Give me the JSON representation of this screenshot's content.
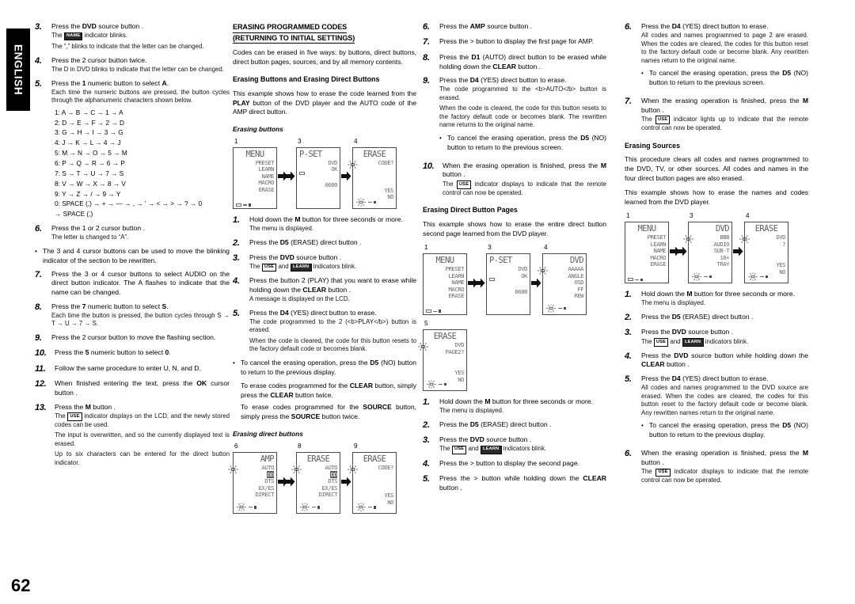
{
  "meta": {
    "language_tab": "ENGLISH",
    "page_number": "62"
  },
  "col1": {
    "steps": [
      {
        "num": "3.",
        "lead_pre": "Press the ",
        "lead_b": "DVD",
        "lead_post": " source button .",
        "notes": [
          "The NAME indicator blinks.",
          "The “,” blinks to indicate that the letter can be changed."
        ],
        "chip": "NAME"
      },
      {
        "num": "4.",
        "lead": "Press the 2  cursor button twice.",
        "notes": [
          "The D in DVD blinks to indicate that the letter can be changed."
        ]
      },
      {
        "num": "5.",
        "lead_pre": "Press the ",
        "lead_b": "1",
        "lead_mid": " numeric button to select ",
        "lead_b2": "A",
        "lead_post": ".",
        "notes": [
          "Each time the numeric buttons are pressed, the button cycles through the alphanumeric characters shown below."
        ]
      },
      {
        "num": "6.",
        "lead": "Press the 1 or 2 cursor button .",
        "notes": [
          "The letter is changed to “A”."
        ]
      },
      {
        "num": "7.",
        "lead": "Press the 3  or 4  cursor buttons to select AUDIO on the direct button indicator. The A flashes to indicate that the name can be changed."
      },
      {
        "num": "8.",
        "lead_pre": "Press the ",
        "lead_b": "7",
        "lead_mid": " numeric button to select ",
        "lead_b2": "S",
        "lead_post": ".",
        "notes": [
          "Each time the button is pressed, the button cycles through S → T → U → 7 → S."
        ]
      },
      {
        "num": "9.",
        "lead": "Press the 2  cursor button to move the flashing section."
      },
      {
        "num": "10.",
        "lead_pre": "Press the ",
        "lead_b": "5",
        "lead_mid": " numeric button to select ",
        "lead_b2": "0",
        "lead_post": "."
      },
      {
        "num": "11.",
        "lead": "Follow the same procedure to enter U, N, and D."
      },
      {
        "num": "12.",
        "lead_pre": "When finished entering the text, press the ",
        "lead_b": "OK",
        "lead_post": " cursor button ."
      },
      {
        "num": "13.",
        "lead_pre": "Press the ",
        "lead_b": "M",
        "lead_post": " button .",
        "notes": [
          "The USE indicator displays on the LCD, and the newly stored codes can be used.",
          "The input is overwritten, and so the currently displayed text is erased.",
          "Up to six characters can be entered for the direct button indicator."
        ]
      }
    ],
    "bullet_after_6": "The 3  and 4  cursor buttons can be used to move the blinking indicator of the section to be rewritten.",
    "cycle": [
      "1: A → B → C → 1 → A",
      "2: D → E → F → 2 → D",
      "3: G → H → I → 3 → G",
      "4: J → K → L → 4 → J",
      "5: M → N → O → 5 → M",
      "6: P → Q → R → 6 → P",
      "7: S → T → U → 7 → S",
      "8: V → W → X → 8 → V",
      "9: Y → Z → / → 9 → Y",
      "0: SPACE (,̈) → + → — → , → ' → < → > → ? → 0",
      "→ SPACE (,̈)"
    ]
  },
  "col2": {
    "section_title_l1": "ERASING PROGRAMMED CODES",
    "section_title_l2": "(RETURNING TO INITIAL SETTINGS)",
    "intro": "Codes can be erased in five ways: by buttons, direct buttons, direct button pages, sources, and by all memory contents.",
    "sub_title": "Erasing Buttons and Erasing Direct Buttons",
    "sub_intro_a": "This example shows how to erase the code learned from the ",
    "sub_intro_b": "PLAY",
    "sub_intro_c": " button of the DVD player and the AUTO code of the AMP direct button.",
    "diagram1_title": "Erasing buttons",
    "diagram1": [
      {
        "cap": "1",
        "title": "MENU",
        "title_align": "center",
        "items": [
          "PRESET",
          "LEARN",
          "NAME",
          "MACRO",
          "ERASE"
        ],
        "foot": "box-dash-sq"
      },
      {
        "cap": "3",
        "title": "P-SET",
        "title_align": "left",
        "right_lines": [
          "DVD",
          "OK"
        ],
        "bottom_right": "0600",
        "foot": "box-only-left"
      },
      {
        "cap": "4",
        "title": "ERASE",
        "title_align": "center",
        "right_lines": [
          "CODE?"
        ],
        "yesno": [
          "YES",
          "NO"
        ],
        "foot": "blink-dash-sq",
        "blink_left": true
      }
    ],
    "steps": [
      {
        "num": "1.",
        "lead_pre": "Hold down the ",
        "lead_b": "M",
        "lead_post": " button for three seconds or more.",
        "notes": [
          "The menu is displayed."
        ]
      },
      {
        "num": "2.",
        "lead_pre": "Press the ",
        "lead_b": "D5",
        "lead_post": " (ERASE) direct button ."
      },
      {
        "num": "3.",
        "lead_pre": "Press the ",
        "lead_b": "DVD",
        "lead_post": " source button .",
        "notes": [
          "The USE and LEARN indicators blink."
        ]
      },
      {
        "num": "4.",
        "lead_pre": "Press the button 2  (PLAY) that you want to erase while holding down the ",
        "lead_b": "CLEAR",
        "lead_post": " button .",
        "notes": [
          "A message is displayed on the LCD."
        ]
      },
      {
        "num": "5.",
        "lead_pre": "Press the ",
        "lead_b": "D4",
        "lead_post": " (YES) direct button to erase.",
        "notes": [
          "The code programmed to the 2  (PLAY) button is erased.",
          "When the code is cleared, the code for this button resets to the factory default code or becomes blank."
        ]
      }
    ],
    "bullet": "To cancel the erasing operation, press the D5 (NO) button to return to the previous display.",
    "sub_paras": [
      "To erase codes programmed for the CLEAR button, simply press the CLEAR button twice.",
      "To erase codes programmed for the SOURCE button, simply press the SOURCE button twice."
    ],
    "diagram2_title": "Erasing direct buttons",
    "diagram2": [
      {
        "cap": "6",
        "title": "AMP",
        "title_align": "right",
        "items": [
          "AUTO",
          "DD",
          "DTS",
          "EX/ES",
          "DIRECT"
        ],
        "invert_index": 1,
        "foot": "blink-box-dash-sq",
        "blink_left": true
      },
      {
        "cap": "8",
        "title": "ERASE",
        "title_align": "center",
        "items": [
          "AUTO",
          "DD",
          "DTS",
          "EX/ES",
          "DIRECT"
        ],
        "invert_index": 1,
        "foot": "blink-dash-sq",
        "blink_left": true
      },
      {
        "cap": "9",
        "title": "ERASE",
        "title_align": "center",
        "right_lines": [
          "CODE?"
        ],
        "yesno": [
          "YES",
          "NO"
        ],
        "foot": "blink-dash-sq",
        "blink_left": true
      }
    ]
  },
  "col3": {
    "steps_top": [
      {
        "num": "6.",
        "lead_pre": "Press the ",
        "lead_b": "AMP",
        "lead_post": " source button ."
      },
      {
        "num": "7.",
        "lead": "Press the > button to display the first page for AMP."
      },
      {
        "num": "8.",
        "lead_pre": "Press the ",
        "lead_b": "D1",
        "lead_mid": " (AUTO) direct button to be erased while holding down the ",
        "lead_b2": "CLEAR",
        "lead_post": " button ."
      },
      {
        "num": "9.",
        "lead_pre": "Press the ",
        "lead_b": "D4",
        "lead_post": " (YES) direct button to erase.",
        "notes": [
          "The code programmed to the AUTO button is erased.",
          "When the code is cleared, the code for this button resets to the factory default code or becomes blank. The rewritten name returns to the original name."
        ]
      },
      {
        "num": "10.",
        "lead_pre": "When the erasing operation is finished, press the ",
        "lead_b": "M",
        "lead_post": " button .",
        "notes": [
          "The USE indicator displays to indicate that the remote control can now be operated."
        ]
      }
    ],
    "bullet9": "To cancel the erasing operation, press the D5 (NO) button to return to the previous screen.",
    "sub_title": "Erasing Direct Button Pages",
    "sub_intro": "This example shows how to erase the entire direct button second page learned from the DVD player.",
    "diagram": [
      {
        "cap": "1",
        "title": "MENU",
        "title_align": "center",
        "items": [
          "PRESET",
          "LEARN",
          "NAME",
          "MACRO",
          "ERASE"
        ],
        "foot": "box-dash-sq"
      },
      {
        "cap": "3",
        "title": "P-SET",
        "title_align": "left",
        "right_lines": [
          "DVD",
          "OK"
        ],
        "bottom_right": "0600",
        "foot": "box-only-left"
      },
      {
        "cap": "4",
        "title": "DVD",
        "title_align": "right",
        "items": [
          "AAAAA",
          "ANGLE",
          "OSD",
          "FF",
          "REW"
        ],
        "foot": "blink-dash-sq",
        "blink_left": true
      }
    ],
    "diagram_extra": {
      "cap": "5",
      "title": "ERASE",
      "title_align": "center",
      "right_lines": [
        "DVD",
        "PAGE2?"
      ],
      "yesno": [
        "YES",
        "NO"
      ],
      "foot": "blink-dash-sq",
      "blink_left": true
    },
    "steps_bottom": [
      {
        "num": "1.",
        "lead_pre": "Hold down the ",
        "lead_b": "M",
        "lead_post": " button for three seconds or more.",
        "notes": [
          "The menu is displayed."
        ]
      },
      {
        "num": "2.",
        "lead_pre": "Press the ",
        "lead_b": "D5",
        "lead_post": " (ERASE) direct button ."
      },
      {
        "num": "3.",
        "lead_pre": "Press the ",
        "lead_b": "DVD",
        "lead_post": " source button .",
        "notes": [
          "The USE and LEARN indicators blink."
        ]
      },
      {
        "num": "4.",
        "lead": "Press the > button to display the second page."
      },
      {
        "num": "5.",
        "lead_pre": "Press the > button while holding down the ",
        "lead_b": "CLEAR",
        "lead_post": " button ."
      }
    ]
  },
  "col4": {
    "steps_top": [
      {
        "num": "6.",
        "lead_pre": "Press the ",
        "lead_b": "D4",
        "lead_post": " (YES) direct button to erase.",
        "notes": [
          "All codes and names programmed to page 2 are erased. When the codes are cleared, the codes for this button reset to the factory default code or become blank. Any rewritten names return to the original name."
        ]
      },
      {
        "num": "7.",
        "lead_pre": "When the erasing operation is finished, press the ",
        "lead_b": "M",
        "lead_post": " button .",
        "notes": [
          "The USE indicator lights up to indicate that the remote control can now be operated."
        ]
      }
    ],
    "bullet6": "To cancel the erasing operation, press the D5 (NO) button to return to the previous screen.",
    "sub_title": "Erasing Sources",
    "intro1": "This procedure clears all codes and names programmed to the DVD, TV, or other sources. All codes and names in the four direct button pages are also erased.",
    "intro2": "This example shows how to erase the names and codes learned from the DVD player.",
    "diagram": [
      {
        "cap": "1",
        "title": "MENU",
        "title_align": "center",
        "items": [
          "PRESET",
          "LEARN",
          "NAME",
          "MACRO",
          "ERASE"
        ],
        "foot": "box-dash-sq"
      },
      {
        "cap": "3",
        "title": "DVD",
        "title_align": "right",
        "items": [
          "BBB",
          "AUDIO",
          "SUB-T",
          "10+",
          "TRAY"
        ],
        "foot": "blink-box-dash-sq",
        "blink_left": true
      },
      {
        "cap": "4",
        "title": "ERASE",
        "title_align": "center",
        "right_lines": [
          "DVD",
          "?"
        ],
        "yesno": [
          "YES",
          "NO"
        ],
        "foot": "blink-dash-sq",
        "blink_left": true
      }
    ],
    "steps_bottom": [
      {
        "num": "1.",
        "lead_pre": "Hold down the ",
        "lead_b": "M",
        "lead_post": " button for three seconds or more.",
        "notes": [
          "The menu is displayed."
        ]
      },
      {
        "num": "2.",
        "lead_pre": "Press the ",
        "lead_b": "D5",
        "lead_post": " (ERASE) direct button ."
      },
      {
        "num": "3.",
        "lead_pre": "Press the ",
        "lead_b": "DVD",
        "lead_post": " source button .",
        "notes": [
          "The USE and LEARN indicators blink."
        ]
      },
      {
        "num": "4.",
        "lead_pre": "Press the ",
        "lead_b": "DVD",
        "lead_mid": " source button while holding down the ",
        "lead_b2": "CLEAR",
        "lead_post": " button ."
      },
      {
        "num": "5.",
        "lead_pre": "Press the ",
        "lead_b": "D4",
        "lead_post": " (YES) direct button to erase.",
        "notes": [
          "All codes and names programmed to the DVD source are erased. When the codes are cleared, the codes for this button reset to the factory default code or become blank. Any rewritten names return to the original name."
        ]
      },
      {
        "num": "6.",
        "lead_pre": "When the erasing operation is finished, press the ",
        "lead_b": "M",
        "lead_post": " button .",
        "notes": [
          "The USE indicator displays to indicate that the remote control can now be operated."
        ]
      }
    ],
    "bullet5": "To cancel the erasing operation, press the D5 (NO) button to return to the previous display."
  },
  "chips": {
    "use": "USE",
    "learn": "LEARN",
    "name": "NAME"
  },
  "colors": {
    "text": "#000000",
    "lcd_text": "#6b6b6b",
    "lcd_border": "#4a4a4a",
    "tab_bg": "#000000"
  }
}
